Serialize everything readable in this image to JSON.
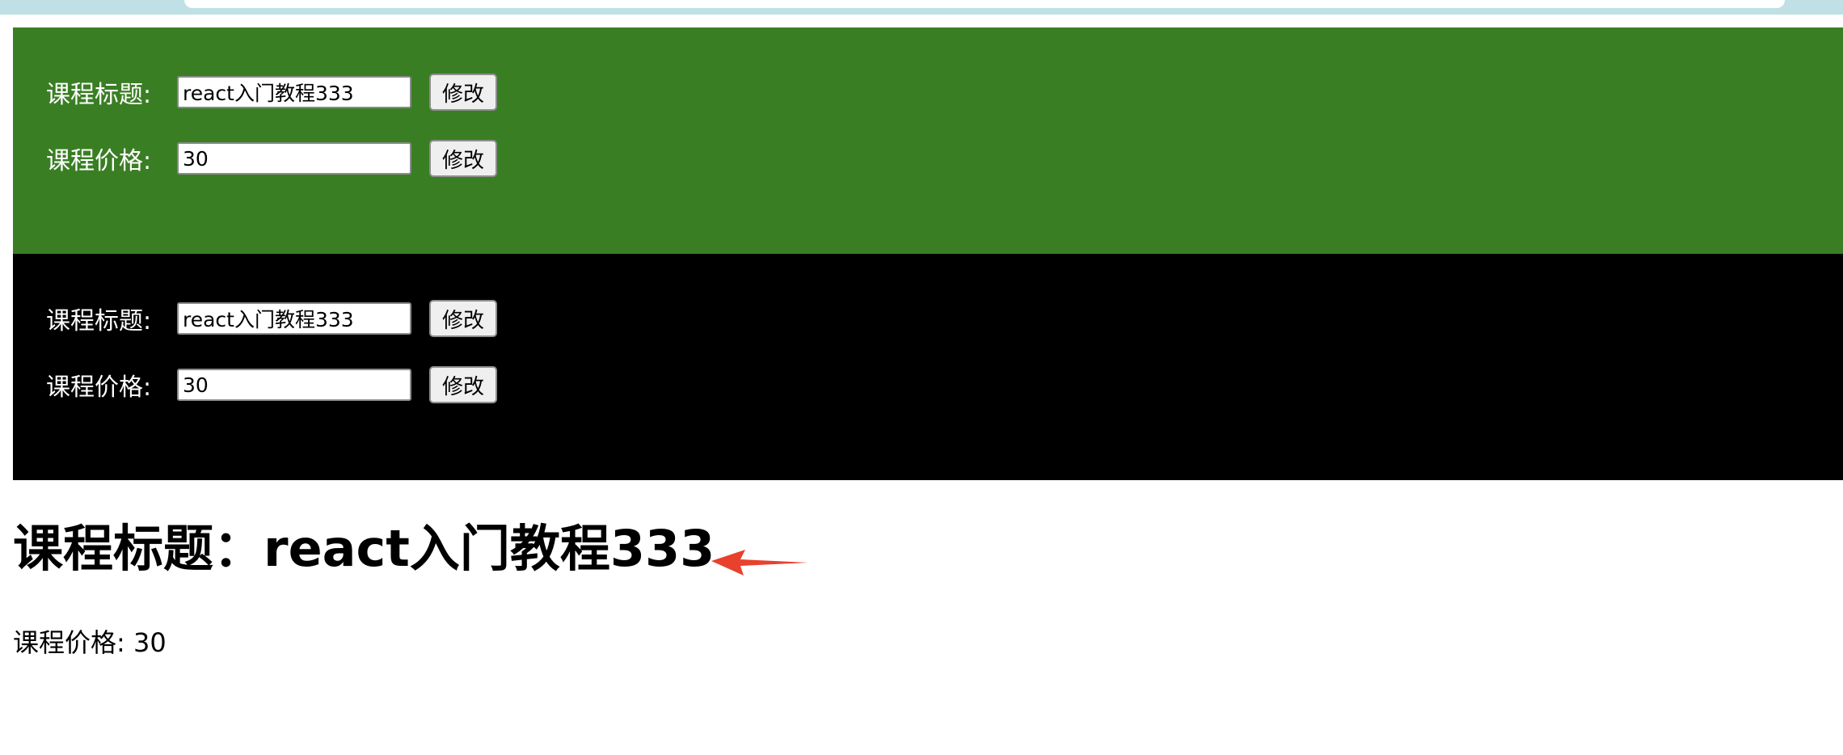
{
  "course": {
    "title_label": "课程标题:",
    "price_label": "课程价格:",
    "title_value": "react入门教程333",
    "price_value": "30",
    "edit_label": "修改"
  },
  "display": {
    "title_text": "课程标题：react入门教程333",
    "price_text": "课程价格: 30"
  },
  "colors": {
    "green_panel": "#3a7e24",
    "black_panel": "#000000",
    "arrow": "#e8412c"
  },
  "icons": {
    "annotation": "arrow-left-icon"
  }
}
